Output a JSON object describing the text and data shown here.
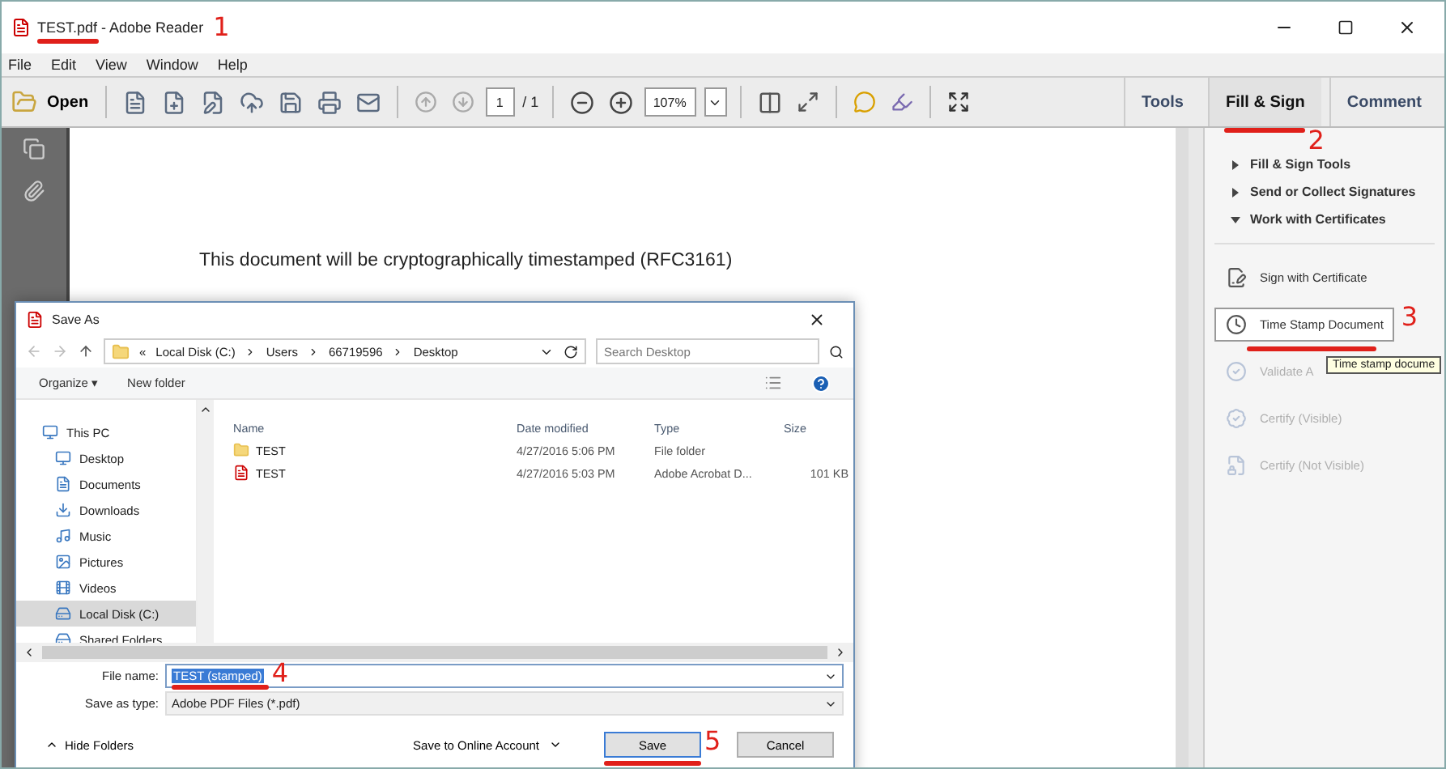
{
  "window": {
    "title": "TEST.pdf - Adobe Reader"
  },
  "menu": [
    "File",
    "Edit",
    "View",
    "Window",
    "Help"
  ],
  "toolbar": {
    "open": "Open",
    "page": "1",
    "page_total": "/ 1",
    "zoom": "107%"
  },
  "panel_tabs": [
    {
      "label": "Tools",
      "selected": false
    },
    {
      "label": "Fill & Sign",
      "selected": true
    },
    {
      "label": "Comment",
      "selected": false
    }
  ],
  "document": {
    "text": "This document will be cryptographically timestamped (RFC3161)"
  },
  "panel": {
    "sections": [
      {
        "label": "Fill & Sign Tools",
        "expanded": false
      },
      {
        "label": "Send or Collect Signatures",
        "expanded": false
      },
      {
        "label": "Work with Certificates",
        "expanded": true
      }
    ],
    "items": [
      {
        "label": "Sign with Certificate",
        "selected": false,
        "disabled": false
      },
      {
        "label": "Time Stamp Document",
        "selected": true,
        "disabled": false
      },
      {
        "label": "Validate A",
        "selected": false,
        "disabled": true
      },
      {
        "label": "Certify (Visible)",
        "selected": false,
        "disabled": true
      },
      {
        "label": "Certify (Not Visible)",
        "selected": false,
        "disabled": true
      }
    ]
  },
  "tooltip": "Time stamp docume",
  "dialog": {
    "title": "Save As",
    "breadcrumb": [
      "«",
      "Local Disk (C:)",
      "Users",
      "66719596",
      "Desktop"
    ],
    "search": {
      "placeholder": "Search Desktop"
    },
    "commands": [
      "Organize ▾",
      "New folder"
    ],
    "nav": [
      {
        "label": "This PC",
        "selected": false
      },
      {
        "label": "Desktop",
        "selected": false
      },
      {
        "label": "Documents",
        "selected": false
      },
      {
        "label": "Downloads",
        "selected": false
      },
      {
        "label": "Music",
        "selected": false
      },
      {
        "label": "Pictures",
        "selected": false
      },
      {
        "label": "Videos",
        "selected": false
      },
      {
        "label": "Local Disk (C:)",
        "selected": true
      },
      {
        "label": "Shared Folders",
        "selected": false
      }
    ],
    "columns": [
      "Name",
      "Date modified",
      "Type",
      "Size"
    ],
    "files": [
      {
        "kind": "folder",
        "name": "TEST",
        "date": "4/27/2016 5:06 PM",
        "type": "File folder"
      },
      {
        "kind": "pdf",
        "name": "TEST",
        "date": "4/27/2016 5:03 PM",
        "type": "Adobe Acrobat D...",
        "size": "101 KB"
      }
    ],
    "file_name_label": "File name:",
    "file_name": "TEST (stamped)",
    "type_label": "Save as type:",
    "type_value": "Adobe PDF Files (*.pdf)",
    "hide_folders": "Hide Folders",
    "online": "Save to Online Account",
    "save": "Save",
    "cancel": "Cancel"
  },
  "annotations": [
    {
      "label": "1"
    },
    {
      "label": "2"
    },
    {
      "label": "3"
    },
    {
      "label": "4"
    },
    {
      "label": "5"
    }
  ]
}
